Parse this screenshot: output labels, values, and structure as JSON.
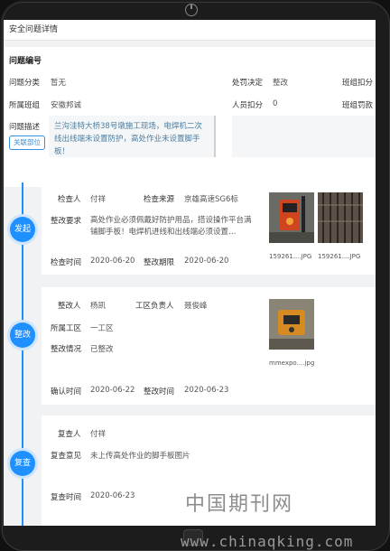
{
  "page": {
    "title": "安全问题详情"
  },
  "info": {
    "section_title": "问题编号",
    "category_label": "问题分类",
    "category_value": "暂无",
    "team_label": "所属班组",
    "team_value": "安徽邦诚",
    "desc_label": "问题描述",
    "desc_value": "兰沟洼特大桥38号墩施工现场，电焊机二次线出线端未设置防护，高处作业未设置脚手板！",
    "link_button": "关联部位",
    "penalty_decision_label": "处罚决定",
    "penalty_decision_value": "整改",
    "team_deduct_label": "班组扣分",
    "person_deduct_label": "人员扣分",
    "person_deduct_value": "0",
    "team_fine_label": "班组罚款"
  },
  "stages": [
    {
      "node": "发起",
      "inspector_label": "检查人",
      "inspector_value": "付祥",
      "source_label": "检查来源",
      "source_value": "京雄高速SG6标",
      "req_label": "整改要求",
      "req_value": "高处作业必须佩戴好防护用品，搭设操作平台满铺脚手板！电焊机进线和出线端必须设置…",
      "check_time_label": "检查时间",
      "check_time_value": "2020-06-20",
      "deadline_label": "整改期限",
      "deadline_value": "2020-06-20",
      "images": [
        {
          "caption": "159261....JPG"
        },
        {
          "caption": "159261....JPG"
        }
      ]
    },
    {
      "node": "整改",
      "rectifier_label": "整改人",
      "rectifier_value": "杨凯",
      "leader_label": "工区负责人",
      "leader_value": "聂俊峰",
      "zone_label": "所属工区",
      "zone_value": "一工区",
      "status_label": "整改情况",
      "status_value": "已整改",
      "confirm_label": "确认时间",
      "confirm_value": "2020-06-22",
      "rect_time_label": "整改时间",
      "rect_time_value": "2020-06-23",
      "images": [
        {
          "caption": "mmexpo....jpg"
        }
      ]
    },
    {
      "node": "复查",
      "reviewer_label": "复查人",
      "reviewer_value": "付祥",
      "opinion_label": "复查意见",
      "opinion_value": "未上传高处作业的脚手板图片",
      "review_time_label": "复查时间",
      "review_time_value": "2020-06-23"
    }
  ],
  "watermark": {
    "cn": "中国期刊网",
    "url": "www.chinaqking.com"
  }
}
